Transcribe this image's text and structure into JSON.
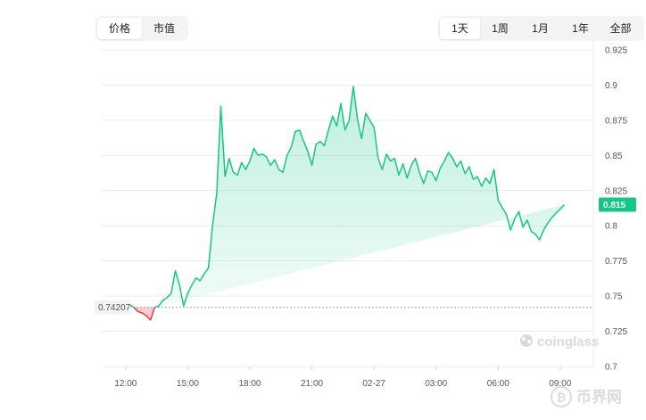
{
  "metric_tabs": [
    {
      "label": "价格",
      "active": true
    },
    {
      "label": "市值",
      "active": false
    }
  ],
  "range_tabs": [
    {
      "label": "1天",
      "active": true
    },
    {
      "label": "1周",
      "active": false
    },
    {
      "label": "1月",
      "active": false
    },
    {
      "label": "1年",
      "active": false
    },
    {
      "label": "全部",
      "active": false
    }
  ],
  "chart_data": {
    "type": "area",
    "xlabel": "",
    "ylabel": "",
    "x_tick_labels": [
      "12:00",
      "15:00",
      "18:00",
      "21:00",
      "02-27",
      "03:00",
      "06:00",
      "09:00"
    ],
    "x_tick_hours": [
      0,
      3,
      6,
      9,
      12,
      15,
      18,
      21
    ],
    "y_ticks": [
      0.7,
      0.725,
      0.75,
      0.775,
      0.8,
      0.825,
      0.85,
      0.875,
      0.9,
      0.925
    ],
    "ylim": [
      0.7,
      0.925
    ],
    "xlim_hours": [
      -1.2,
      22.6
    ],
    "baseline": {
      "value": 0.74207,
      "label": "0.74207"
    },
    "current": {
      "value": 0.815,
      "label": "0.815"
    },
    "grid": true,
    "colors": {
      "up": "#16c784",
      "down": "#ea3943",
      "badge": "#16c784",
      "grid": "#ececec"
    },
    "series": [
      {
        "x_hours": [
          0.2,
          0.4,
          0.6,
          0.8,
          1.0,
          1.2,
          1.4,
          1.6,
          1.8,
          2.0,
          2.2,
          2.4,
          2.6,
          2.8,
          3.0,
          3.2,
          3.4,
          3.6,
          3.8,
          4.0,
          4.2,
          4.4,
          4.6,
          4.8,
          5.0,
          5.2,
          5.4,
          5.6,
          5.8,
          6.0,
          6.2,
          6.4,
          6.6,
          6.8,
          7.0,
          7.2,
          7.4,
          7.6,
          7.8,
          8.0,
          8.2,
          8.4,
          8.6,
          8.8,
          9.0,
          9.2,
          9.4,
          9.6,
          9.8,
          10.0,
          10.2,
          10.4,
          10.6,
          10.8,
          11.0,
          11.2,
          11.4,
          11.6,
          11.8,
          12.0,
          12.2,
          12.4,
          12.6,
          12.8,
          13.0,
          13.2,
          13.4,
          13.6,
          13.8,
          14.0,
          14.2,
          14.4,
          14.6,
          14.8,
          15.0,
          15.2,
          15.4,
          15.6,
          15.8,
          16.0,
          16.2,
          16.4,
          16.6,
          16.8,
          17.0,
          17.2,
          17.4,
          17.6,
          17.8,
          18.0,
          18.2,
          18.4,
          18.6,
          18.8,
          19.0,
          19.2,
          19.4,
          19.6,
          19.8,
          20.0,
          20.2,
          20.4,
          20.6,
          20.8,
          21.0,
          21.2,
          21.4,
          21.6,
          21.8,
          22.0,
          22.2,
          22.4
        ],
        "values": [
          0.744,
          0.742,
          0.739,
          0.738,
          0.736,
          0.733,
          0.742,
          0.743,
          0.747,
          0.749,
          0.752,
          0.768,
          0.758,
          0.743,
          0.752,
          0.758,
          0.763,
          0.761,
          0.766,
          0.77,
          0.8,
          0.823,
          0.885,
          0.835,
          0.848,
          0.838,
          0.836,
          0.845,
          0.84,
          0.846,
          0.855,
          0.85,
          0.851,
          0.849,
          0.843,
          0.847,
          0.84,
          0.838,
          0.85,
          0.856,
          0.867,
          0.868,
          0.86,
          0.853,
          0.843,
          0.858,
          0.86,
          0.857,
          0.868,
          0.878,
          0.871,
          0.887,
          0.868,
          0.875,
          0.899,
          0.876,
          0.862,
          0.88,
          0.875,
          0.87,
          0.848,
          0.84,
          0.851,
          0.846,
          0.848,
          0.836,
          0.844,
          0.834,
          0.843,
          0.848,
          0.838,
          0.83,
          0.839,
          0.838,
          0.832,
          0.841,
          0.846,
          0.852,
          0.848,
          0.842,
          0.846,
          0.837,
          0.842,
          0.833,
          0.835,
          0.828,
          0.834,
          0.83,
          0.84,
          0.818,
          0.813,
          0.808,
          0.797,
          0.805,
          0.81,
          0.799,
          0.804,
          0.796,
          0.794,
          0.79,
          0.797,
          0.802,
          0.806,
          0.809,
          0.812,
          0.815
        ]
      }
    ]
  },
  "watermarks": {
    "brand": "coinglass",
    "site": "币界网"
  }
}
